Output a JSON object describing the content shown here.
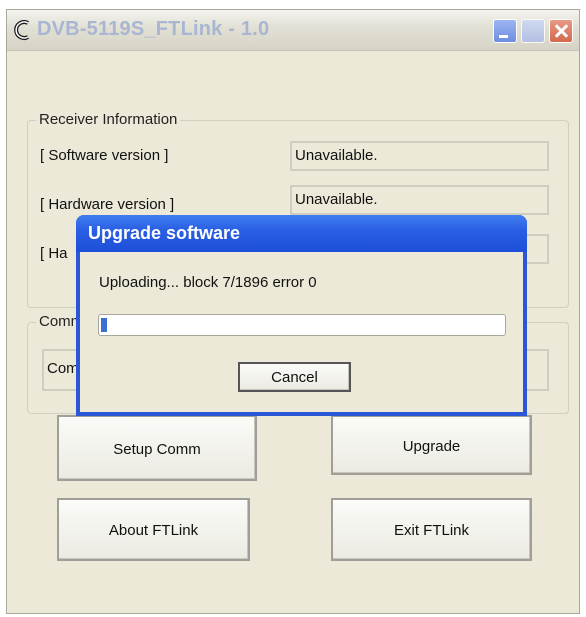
{
  "window": {
    "title": "DVB-5119S_FTLink - 1.0"
  },
  "receiver": {
    "group_label": "Receiver Information",
    "rows": [
      {
        "label": "[ Software version ]",
        "value": "Unavailable."
      },
      {
        "label": "[ Hardware version ]",
        "value": "Unavailable."
      },
      {
        "label": "[ Ha",
        "value": ""
      }
    ]
  },
  "comm": {
    "group_label": "Comm",
    "field_value": "Com"
  },
  "buttons": {
    "setup_comm": "Setup Comm",
    "upgrade": "Upgrade",
    "about": "About FTLink",
    "exit": "Exit FTLink"
  },
  "dialog": {
    "title": "Upgrade software",
    "status": "Uploading...  block 7/1896   error 0",
    "progress_fraction": 0.004,
    "cancel_label": "Cancel"
  },
  "colors": {
    "dialog_title_bar": "#2a5fe3",
    "progress_fill": "#3b6fd4",
    "close_button": "#d2694d"
  },
  "icons": [
    "app-icon",
    "minimize-icon",
    "maximize-icon",
    "close-icon"
  ]
}
